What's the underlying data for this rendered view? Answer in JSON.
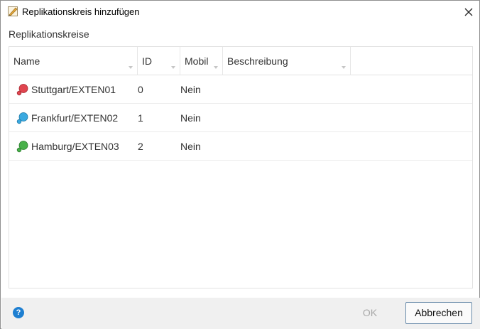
{
  "window": {
    "title": "Replikationskreis hinzufügen",
    "app_icon": "document-pencil-icon",
    "close_icon": "close-icon"
  },
  "section_label": "Replikationskreise",
  "table": {
    "columns": [
      "Name",
      "ID",
      "Mobil",
      "Beschreibung"
    ],
    "rows": [
      {
        "name": "Stuttgart/EXTEN01",
        "id": "0",
        "mobil": "Nein",
        "beschreibung": "",
        "icon": "red-circle-icon",
        "color": "#e0454f"
      },
      {
        "name": "Frankfurt/EXTEN02",
        "id": "1",
        "mobil": "Nein",
        "beschreibung": "",
        "icon": "blue-circle-icon",
        "color": "#3aa9e0"
      },
      {
        "name": "Hamburg/EXTEN03",
        "id": "2",
        "mobil": "Nein",
        "beschreibung": "",
        "icon": "green-circle-icon",
        "color": "#48b04a"
      }
    ]
  },
  "footer": {
    "help_icon": "help-icon",
    "help_glyph": "?",
    "ok_label": "OK",
    "cancel_label": "Abbrechen"
  }
}
